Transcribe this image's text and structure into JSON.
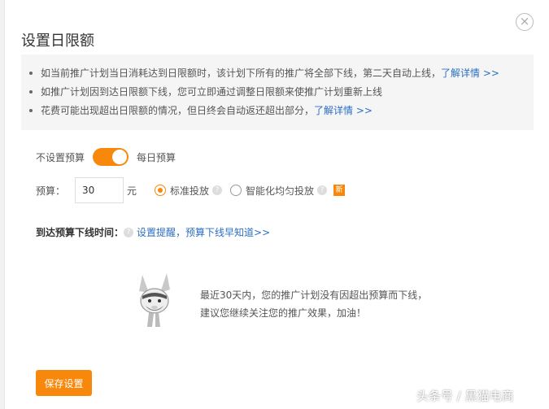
{
  "dialog": {
    "title": "设置日限额",
    "close_glyph": "×"
  },
  "notice": {
    "items": [
      {
        "text": "如当前推广计划当日消耗达到日限额时，该计划下所有的推广将全部下线，第二天自动上线，",
        "link": "了解详情 >>"
      },
      {
        "text": "如推广计划因到达日限额下线，您可立即通过调整日限额来使推广计划重新上线",
        "link": ""
      },
      {
        "text": "花费可能出现超出日限额的情况，但日终会自动返还超出部分，",
        "link": "了解详情 >>"
      }
    ]
  },
  "budget_toggle": {
    "off_label": "不设置预算",
    "on_label": "每日预算",
    "enabled": true
  },
  "budget": {
    "label": "预算：",
    "value": "30",
    "unit": "元",
    "options": [
      {
        "label": "标准投放",
        "selected": true
      },
      {
        "label": "智能化均匀投放",
        "selected": false
      }
    ],
    "new_badge": "新"
  },
  "offline_time": {
    "label": "到达预算下线时间：",
    "link": "设置提醒，预算下线早知道>>"
  },
  "empty_state": {
    "line1": "最近30天内，您的推广计划没有因超出预算而下线，",
    "line2": "建议您继续关注您的推广效果，加油！"
  },
  "save_label": "保存设置",
  "watermark": "头条号 / 黑猫电商",
  "colors": {
    "accent": "#f7880c",
    "link": "#2b6fc2"
  }
}
